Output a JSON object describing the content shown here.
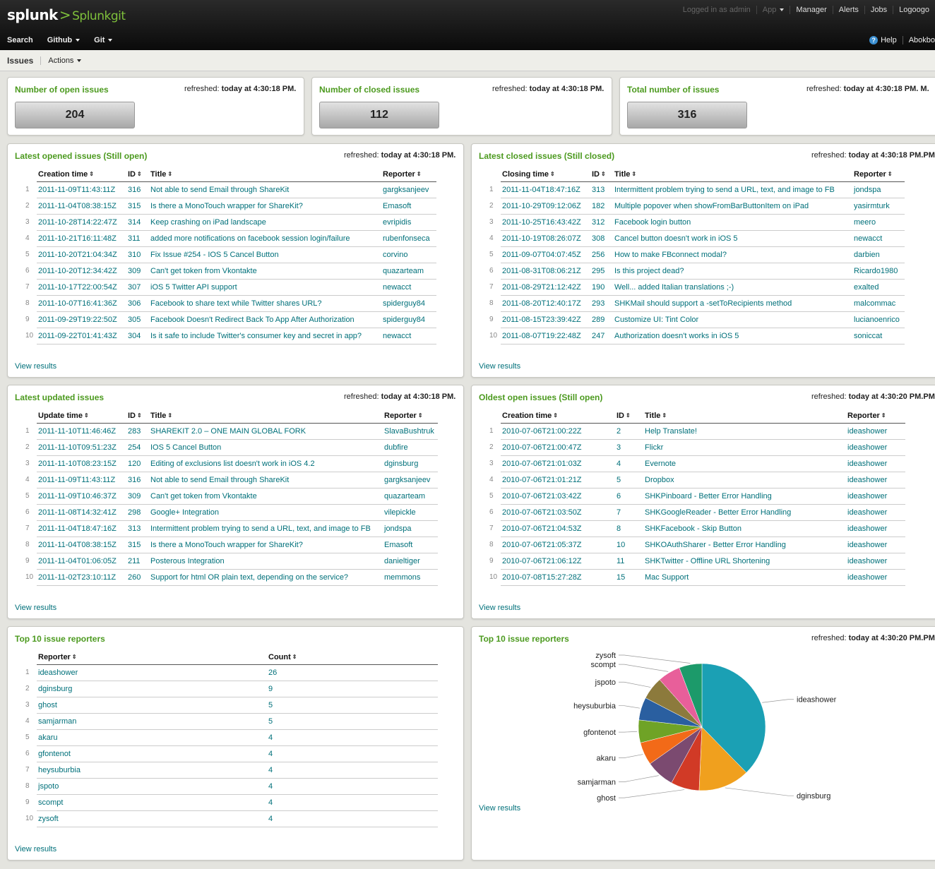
{
  "header": {
    "brand": "splunk",
    "app_name": "Splunkgit",
    "logged_in": "Logged in as admin",
    "top_links": [
      "App",
      "Manager",
      "Alerts",
      "Jobs",
      "Logoogo"
    ],
    "nav": [
      "Search",
      "Github",
      "Git"
    ],
    "help": "Help",
    "about": "Abokbo"
  },
  "subnav": {
    "title": "Issues",
    "actions": "Actions"
  },
  "refreshed_label": "refreshed:",
  "singles": [
    {
      "title": "Number of open issues",
      "refreshed": "today at 4:30:18 PM.",
      "value": "204"
    },
    {
      "title": "Number of closed issues",
      "refreshed": "today at 4:30:18 PM.",
      "value": "112"
    },
    {
      "title": "Total number of issues",
      "refreshed": "today at 4:30:18 PM.",
      "extra": "M.",
      "value": "316"
    }
  ],
  "opened": {
    "title": "Latest opened issues (Still open)",
    "refreshed": "today at 4:30:18 PM.",
    "columns": [
      "Creation time",
      "ID",
      "Title",
      "Reporter"
    ],
    "rows": [
      [
        "2011-11-09T11:43:11Z",
        "316",
        "Not able to send Email through ShareKit",
        "gargksanjeev"
      ],
      [
        "2011-11-04T08:38:15Z",
        "315",
        "Is there a MonoTouch wrapper for ShareKit?",
        "Emasoft"
      ],
      [
        "2011-10-28T14:22:47Z",
        "314",
        "Keep crashing on iPad landscape",
        "evripidis"
      ],
      [
        "2011-10-21T16:11:48Z",
        "311",
        "added more notifications on facebook session login/failure",
        "rubenfonseca"
      ],
      [
        "2011-10-20T21:04:34Z",
        "310",
        "Fix Issue #254 - IOS 5 Cancel Button",
        "corvino"
      ],
      [
        "2011-10-20T12:34:42Z",
        "309",
        "Can't get token from Vkontakte",
        "quazarteam"
      ],
      [
        "2011-10-17T22:00:54Z",
        "307",
        "iOS 5 Twitter API support",
        "newacct"
      ],
      [
        "2011-10-07T16:41:36Z",
        "306",
        "Facebook to share text while Twitter shares URL?",
        "spiderguy84"
      ],
      [
        "2011-09-29T19:22:50Z",
        "305",
        "Facebook Doesn't Redirect Back To App After Authorization",
        "spiderguy84"
      ],
      [
        "2011-09-22T01:41:43Z",
        "304",
        "Is it safe to include Twitter's consumer key and secret in app?",
        "newacct"
      ]
    ],
    "view": "View results"
  },
  "closed": {
    "title": "Latest closed issues (Still closed)",
    "refreshed": "today at 4:30:18 PM.",
    "extra": "PM.",
    "columns": [
      "Closing time",
      "ID",
      "Title",
      "Reporter"
    ],
    "rows": [
      [
        "2011-11-04T18:47:16Z",
        "313",
        "Intermittent problem trying to send a URL, text, and image to FB",
        "jondspa"
      ],
      [
        "2011-10-29T09:12:06Z",
        "182",
        "Multiple popover when showFromBarButtonItem on iPad",
        "yasirmturk"
      ],
      [
        "2011-10-25T16:43:42Z",
        "312",
        "Facebook login button",
        "meero"
      ],
      [
        "2011-10-19T08:26:07Z",
        "308",
        "Cancel button doesn't work in iOS 5",
        "newacct"
      ],
      [
        "2011-09-07T04:07:45Z",
        "256",
        "How to make FBconnect modal?",
        "darbien"
      ],
      [
        "2011-08-31T08:06:21Z",
        "295",
        "Is this project dead?",
        "Ricardo1980"
      ],
      [
        "2011-08-29T21:12:42Z",
        "190",
        "Well... added Italian translations ;-)",
        "exalted"
      ],
      [
        "2011-08-20T12:40:17Z",
        "293",
        "SHKMail should support a -setToRecipients method",
        "malcommac"
      ],
      [
        "2011-08-15T23:39:42Z",
        "289",
        "Customize UI: Tint Color",
        "lucianoenrico"
      ],
      [
        "2011-08-07T19:22:48Z",
        "247",
        "Authorization doesn't works in iOS 5",
        "soniccat"
      ]
    ],
    "view": "View results"
  },
  "updated": {
    "title": "Latest updated issues",
    "refreshed": "today at 4:30:18 PM.",
    "columns": [
      "Update time",
      "ID",
      "Title",
      "Reporter"
    ],
    "rows": [
      [
        "2011-11-10T11:46:46Z",
        "283",
        "SHAREKIT 2.0 – ONE MAIN GLOBAL FORK",
        "SlavaBushtruk"
      ],
      [
        "2011-11-10T09:51:23Z",
        "254",
        "IOS 5 Cancel Button",
        "dubfire"
      ],
      [
        "2011-11-10T08:23:15Z",
        "120",
        "Editing of exclusions list doesn't work in iOS 4.2",
        "dginsburg"
      ],
      [
        "2011-11-09T11:43:11Z",
        "316",
        "Not able to send Email through ShareKit",
        "gargksanjeev"
      ],
      [
        "2011-11-09T10:46:37Z",
        "309",
        "Can't get token from Vkontakte",
        "quazarteam"
      ],
      [
        "2011-11-08T14:32:41Z",
        "298",
        "Google+ Integration",
        "vilepickle"
      ],
      [
        "2011-11-04T18:47:16Z",
        "313",
        "Intermittent problem trying to send a URL, text, and image to FB",
        "jondspa"
      ],
      [
        "2011-11-04T08:38:15Z",
        "315",
        "Is there a MonoTouch wrapper for ShareKit?",
        "Emasoft"
      ],
      [
        "2011-11-04T01:06:05Z",
        "211",
        "Posterous Integration",
        "danieltiger"
      ],
      [
        "2011-11-02T23:10:11Z",
        "260",
        "Support for html OR plain text, depending on the service?",
        "memmons"
      ]
    ],
    "view": "View results"
  },
  "oldest": {
    "title": "Oldest open issues (Still open)",
    "refreshed": "today at 4:30:20 PM.",
    "extra": "PM.",
    "columns": [
      "Creation time",
      "ID",
      "Title",
      "Reporter"
    ],
    "rows": [
      [
        "2010-07-06T21:00:22Z",
        "2",
        "Help Translate!",
        "ideashower"
      ],
      [
        "2010-07-06T21:00:47Z",
        "3",
        "Flickr",
        "ideashower"
      ],
      [
        "2010-07-06T21:01:03Z",
        "4",
        "Evernote",
        "ideashower"
      ],
      [
        "2010-07-06T21:01:21Z",
        "5",
        "Dropbox",
        "ideashower"
      ],
      [
        "2010-07-06T21:03:42Z",
        "6",
        "SHKPinboard - Better Error Handling",
        "ideashower"
      ],
      [
        "2010-07-06T21:03:50Z",
        "7",
        "SHKGoogleReader - Better Error Handling",
        "ideashower"
      ],
      [
        "2010-07-06T21:04:53Z",
        "8",
        "SHKFacebook - Skip Button",
        "ideashower"
      ],
      [
        "2010-07-06T21:05:37Z",
        "10",
        "SHKOAuthSharer - Better Error Handling",
        "ideashower"
      ],
      [
        "2010-07-06T21:06:12Z",
        "11",
        "SHKTwitter - Offline URL Shortening",
        "ideashower"
      ],
      [
        "2010-07-08T15:27:28Z",
        "15",
        "Mac Support",
        "ideashower"
      ]
    ],
    "view": "View results"
  },
  "reporters": {
    "title": "Top 10 issue reporters",
    "columns": [
      "Reporter",
      "Count"
    ],
    "rows": [
      [
        "ideashower",
        "26"
      ],
      [
        "dginsburg",
        "9"
      ],
      [
        "ghost",
        "5"
      ],
      [
        "samjarman",
        "5"
      ],
      [
        "akaru",
        "4"
      ],
      [
        "gfontenot",
        "4"
      ],
      [
        "heysuburbia",
        "4"
      ],
      [
        "jspoto",
        "4"
      ],
      [
        "scompt",
        "4"
      ],
      [
        "zysoft",
        "4"
      ]
    ],
    "view": "View results"
  },
  "chart_data": {
    "type": "pie",
    "title": "Top 10 issue reporters",
    "refreshed": "today at 4:30:20 PM.",
    "extra": "PM.",
    "labels": [
      "ideashower",
      "dginsburg",
      "ghost",
      "samjarman",
      "akaru",
      "gfontenot",
      "heysuburbia",
      "jspoto",
      "scompt",
      "zysoft"
    ],
    "values": [
      26,
      9,
      5,
      5,
      4,
      4,
      4,
      4,
      4,
      4
    ],
    "colors": [
      "#1ba0b4",
      "#f0a01e",
      "#d13a26",
      "#7b4a70",
      "#f26a18",
      "#6fa326",
      "#2a5fa0",
      "#8c7a3c",
      "#e85f9a",
      "#1c9a6a"
    ],
    "view": "View results"
  }
}
